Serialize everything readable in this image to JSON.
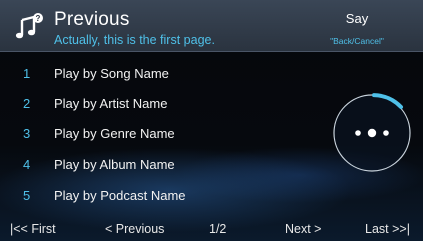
{
  "header": {
    "icon": "music-note-question-icon",
    "title": "Previous",
    "subtitle": "Actually, this is the first page.",
    "say_label": "Say",
    "say_hint": "\"Back/Cancel\""
  },
  "items": [
    {
      "number": "1",
      "label": "Play by Song Name"
    },
    {
      "number": "2",
      "label": "Play by Artist Name"
    },
    {
      "number": "3",
      "label": "Play by Genre Name"
    },
    {
      "number": "4",
      "label": "Play by Album Name"
    },
    {
      "number": "5",
      "label": "Play by Podcast Name"
    }
  ],
  "voice_indicator": {
    "icon": "listening-dots-icon"
  },
  "footer": {
    "first": "|<< First",
    "previous": "< Previous",
    "page": "1/2",
    "next": "Next >",
    "last": "Last >>|"
  },
  "colors": {
    "accent": "#4fc0e8",
    "header_bg": "#333d4a",
    "text": "#ffffff"
  }
}
